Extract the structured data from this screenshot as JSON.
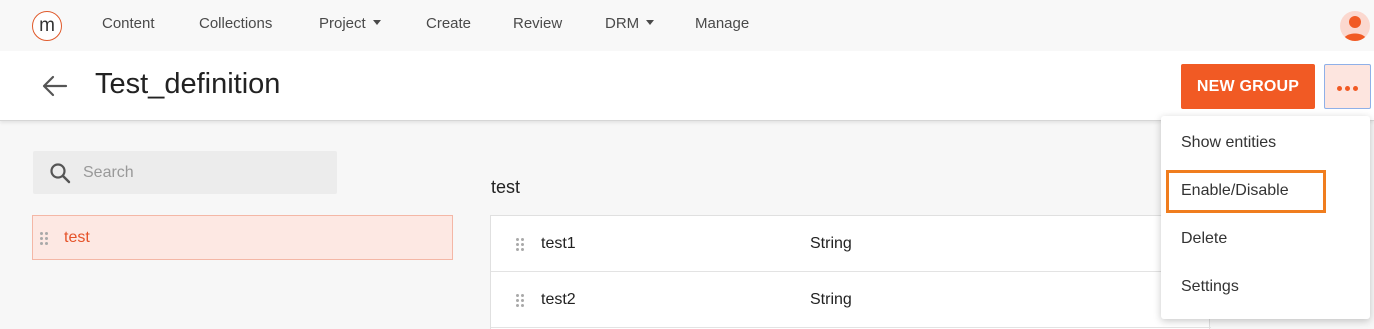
{
  "nav": {
    "logo": "m",
    "items": [
      {
        "label": "Content"
      },
      {
        "label": "Collections"
      },
      {
        "label": "Project"
      },
      {
        "label": "Create"
      },
      {
        "label": "Review"
      },
      {
        "label": "DRM"
      },
      {
        "label": "Manage"
      }
    ]
  },
  "header": {
    "title": "Test_definition",
    "new_group_label": "NEW GROUP"
  },
  "search": {
    "placeholder": "Search",
    "value": ""
  },
  "groups": [
    {
      "label": "test"
    }
  ],
  "section": {
    "title": "test",
    "rows": [
      {
        "name": "test1",
        "type": "String"
      },
      {
        "name": "test2",
        "type": "String"
      }
    ]
  },
  "menu": {
    "items": [
      {
        "label": "Show entities"
      },
      {
        "label": "Enable/Disable"
      },
      {
        "label": "Delete"
      },
      {
        "label": "Settings"
      }
    ],
    "highlighted": "Enable/Disable"
  },
  "colors": {
    "accent": "#f15a24",
    "highlight": "#f07d1e",
    "selected_bg": "#fde8e3"
  }
}
